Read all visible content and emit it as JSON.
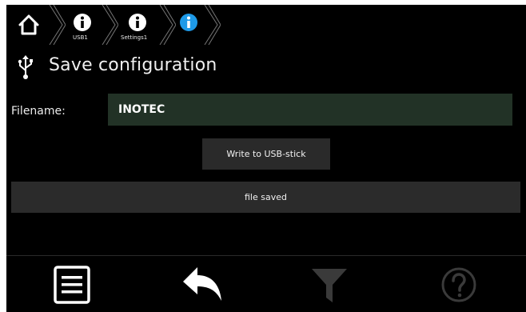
{
  "breadcrumb": {
    "items": [
      {
        "label": "",
        "icon": "home-icon"
      },
      {
        "label": "USB1",
        "icon": "info-icon"
      },
      {
        "label": "Settings1",
        "icon": "info-icon"
      },
      {
        "label": "",
        "icon": "info-icon-active"
      }
    ]
  },
  "header": {
    "icon": "usb-icon",
    "title": "Save configuration"
  },
  "form": {
    "filename_label": "Filename:",
    "filename_value": "INOTEC",
    "write_button_label": "Write to USB-stick",
    "status_text": "file saved"
  },
  "toolbar": {
    "items": [
      {
        "icon": "menu-list-icon",
        "enabled": true
      },
      {
        "icon": "back-arrow-icon",
        "enabled": true
      },
      {
        "icon": "filter-icon",
        "enabled": false
      },
      {
        "icon": "help-icon",
        "enabled": false
      }
    ]
  },
  "colors": {
    "background": "#000000",
    "input_background": "#223226",
    "button_background": "#2a2a2a",
    "active_info": "#1e9ae8",
    "disabled_icon": "#3a3a3a"
  }
}
